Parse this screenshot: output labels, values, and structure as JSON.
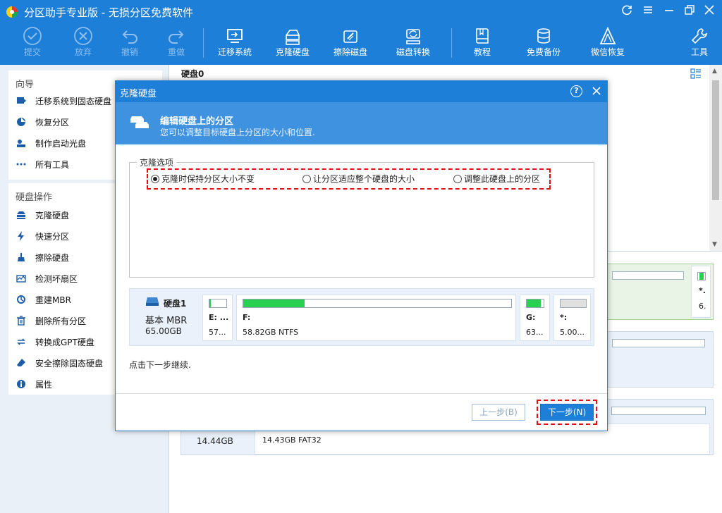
{
  "app": {
    "title": "分区助手专业版 - 无损分区免费软件",
    "accent": "#1e7fd8"
  },
  "toolbar": {
    "items": [
      {
        "label": "提交",
        "icon": "check-circle-icon",
        "enabled": false
      },
      {
        "label": "放弃",
        "icon": "cancel-circle-icon",
        "enabled": false
      },
      {
        "label": "撤销",
        "icon": "undo-icon",
        "enabled": false
      },
      {
        "label": "重做",
        "icon": "redo-icon",
        "enabled": false
      },
      {
        "label": "迁移系统",
        "icon": "migrate-os-icon",
        "enabled": true
      },
      {
        "label": "克隆硬盘",
        "icon": "clone-disk-icon",
        "enabled": true
      },
      {
        "label": "擦除磁盘",
        "icon": "wipe-disk-icon",
        "enabled": true
      },
      {
        "label": "磁盘转换",
        "icon": "convert-disk-icon",
        "enabled": true
      },
      {
        "label": "教程",
        "icon": "book-icon",
        "enabled": true
      },
      {
        "label": "免费备份",
        "icon": "backup-icon",
        "enabled": true
      },
      {
        "label": "微信恢复",
        "icon": "wechat-recovery-icon",
        "enabled": true
      },
      {
        "label": "工具",
        "icon": "wrench-icon",
        "enabled": true
      }
    ]
  },
  "sidebar": {
    "wizard_heading": "向导",
    "wizard_items": [
      {
        "label": "迁移系统到固态硬盘",
        "icon": "migrate-icon"
      },
      {
        "label": "恢复分区",
        "icon": "recover-partition-icon"
      },
      {
        "label": "制作启动光盘",
        "icon": "bootable-media-icon"
      },
      {
        "label": "所有工具",
        "icon": "more-icon"
      }
    ],
    "disk_heading": "硬盘操作",
    "disk_items": [
      {
        "label": "克隆硬盘",
        "icon": "clone-disk-icon"
      },
      {
        "label": "快速分区",
        "icon": "quick-partition-icon"
      },
      {
        "label": "擦除硬盘",
        "icon": "wipe-icon"
      },
      {
        "label": "检测坏扇区",
        "icon": "bad-sector-icon"
      },
      {
        "label": "重建MBR",
        "icon": "rebuild-mbr-icon"
      },
      {
        "label": "删除所有分区",
        "icon": "delete-partitions-icon"
      },
      {
        "label": "转换成GPT硬盘",
        "icon": "convert-gpt-icon"
      },
      {
        "label": "安全擦除固态硬盘",
        "icon": "erase-ssd-icon"
      },
      {
        "label": "属性",
        "icon": "info-icon"
      }
    ]
  },
  "main": {
    "disk_header": "硬盘0",
    "bg_side_labels": [
      "*.",
      "6."
    ],
    "bg_bottom_size": "14.44GB",
    "bg_bottom_fs": "14.43GB FAT32"
  },
  "dialog": {
    "title": "克隆硬盘",
    "help_icon": "?",
    "banner_title": "编辑硬盘上的分区",
    "banner_sub": "您可以调整目标硬盘上分区的大小和位置.",
    "group_label": "克隆选项",
    "options": [
      {
        "label": "克隆时保持分区大小不变",
        "selected": true
      },
      {
        "label": "让分区适应整个硬盘的大小",
        "selected": false
      },
      {
        "label": "调整此硬盘上的分区",
        "selected": false
      }
    ],
    "disk": {
      "name": "硬盘1",
      "type": "基本 MBR",
      "size": "65.00GB",
      "partitions": [
        {
          "letter": "E: ...",
          "detail": "57...",
          "used": 0.08
        },
        {
          "letter": "F:",
          "detail": "58.82GB NTFS",
          "used": 0.23
        },
        {
          "letter": "G:",
          "detail": "63...",
          "used": 0.85
        },
        {
          "letter": "*:",
          "detail": "5.00...",
          "used": 0
        }
      ]
    },
    "hint": "点击下一步继续.",
    "back_label": "上一步(B)",
    "next_label": "下一步(N)"
  }
}
